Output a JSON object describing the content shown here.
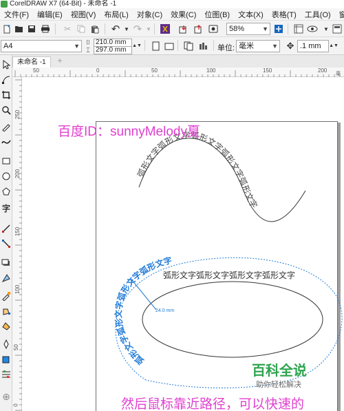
{
  "window": {
    "title": "CorelDRAW X7 (64-Bit) - 未命名 -1"
  },
  "menu": [
    {
      "id": "file",
      "label": "文件(F)"
    },
    {
      "id": "edit",
      "label": "编辑(E)"
    },
    {
      "id": "view",
      "label": "视图(V)"
    },
    {
      "id": "layout",
      "label": "布局(L)"
    },
    {
      "id": "object",
      "label": "对象(C)"
    },
    {
      "id": "effects",
      "label": "效果(C)"
    },
    {
      "id": "bitmaps",
      "label": "位图(B)"
    },
    {
      "id": "text",
      "label": "文本(X)"
    },
    {
      "id": "table",
      "label": "表格(T)"
    },
    {
      "id": "tools",
      "label": "工具(O)"
    },
    {
      "id": "window",
      "label": "窗口(W)"
    }
  ],
  "toolbar": {
    "zoom_value": "58%",
    "paper_size": "A4",
    "page_width": "210.0 mm",
    "page_height": "297.0 mm",
    "units_label": "单位:",
    "units_value": "毫米",
    "nudge_value": ".1 mm"
  },
  "document_tab": {
    "label": "未命名 -1",
    "add_symbol": "+"
  },
  "ruler": {
    "horizontal_labels": [
      "50",
      "0",
      "50",
      "100",
      "150",
      "200"
    ],
    "vertical_labels": [
      "250",
      "200",
      "150",
      "100",
      "50",
      "0"
    ],
    "unit": "毫米"
  },
  "canvas": {
    "watermark_id": "百度ID：sunnyMelody夏",
    "wave_text": "弧形文字弧形文字弧形文字弧形文字弧形文字",
    "ellipse_arc_text": "弧形文字弧形文字弧形文字弧形文字",
    "straight_text": "弧形文字弧形文字弧形文字弧形文字",
    "dimension_label": "24.0 mm",
    "caption": "然后鼠标靠近路径，可以快速的",
    "baike_title": "百科全说",
    "baike_subtitle": "助你轻松解决",
    "colors": {
      "pink": "#e040d0",
      "blue": "#1f7ad6",
      "green": "#2ea44f"
    }
  }
}
